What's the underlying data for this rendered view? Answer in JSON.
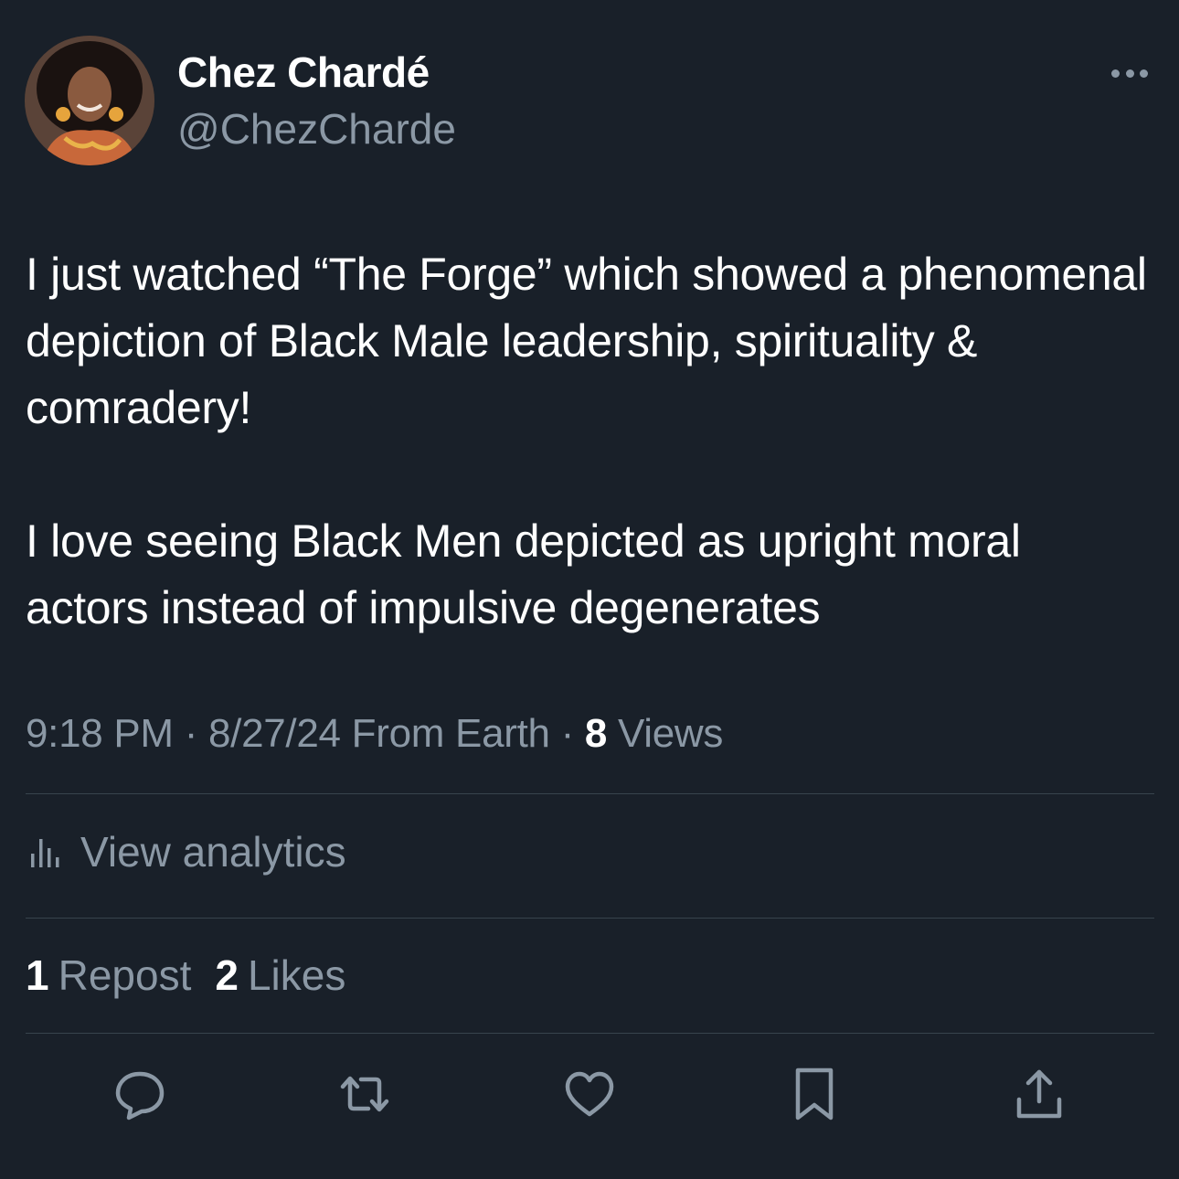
{
  "author": {
    "display_name": "Chez Chardé",
    "handle": "@ChezCharde"
  },
  "tweet": {
    "paragraphs": [
      "I just watched “The Forge” which showed a phenomenal depiction of Black Male leadership, spirituality & comradery!",
      "I love seeing Black Men depicted as upright moral actors instead of impulsive degenerates"
    ],
    "time": "9:18 PM",
    "date": "8/27/24",
    "source": "From Earth",
    "separator": "·",
    "views_count": "8",
    "views_label": "Views"
  },
  "analytics": {
    "label": "View analytics"
  },
  "stats": {
    "reposts_count": "1",
    "reposts_label": "Repost",
    "likes_count": "2",
    "likes_label": "Likes"
  },
  "icons": {
    "more": "more-horizontal-icon",
    "analytics": "bar-chart-icon",
    "reply": "reply-bubble-icon",
    "repost": "repost-arrows-icon",
    "like": "heart-icon",
    "bookmark": "bookmark-icon",
    "share": "share-upload-icon"
  },
  "colors": {
    "background": "#192029",
    "primary_text": "#ffffff",
    "secondary_text": "#8b98a5",
    "divider": "#38444d"
  }
}
